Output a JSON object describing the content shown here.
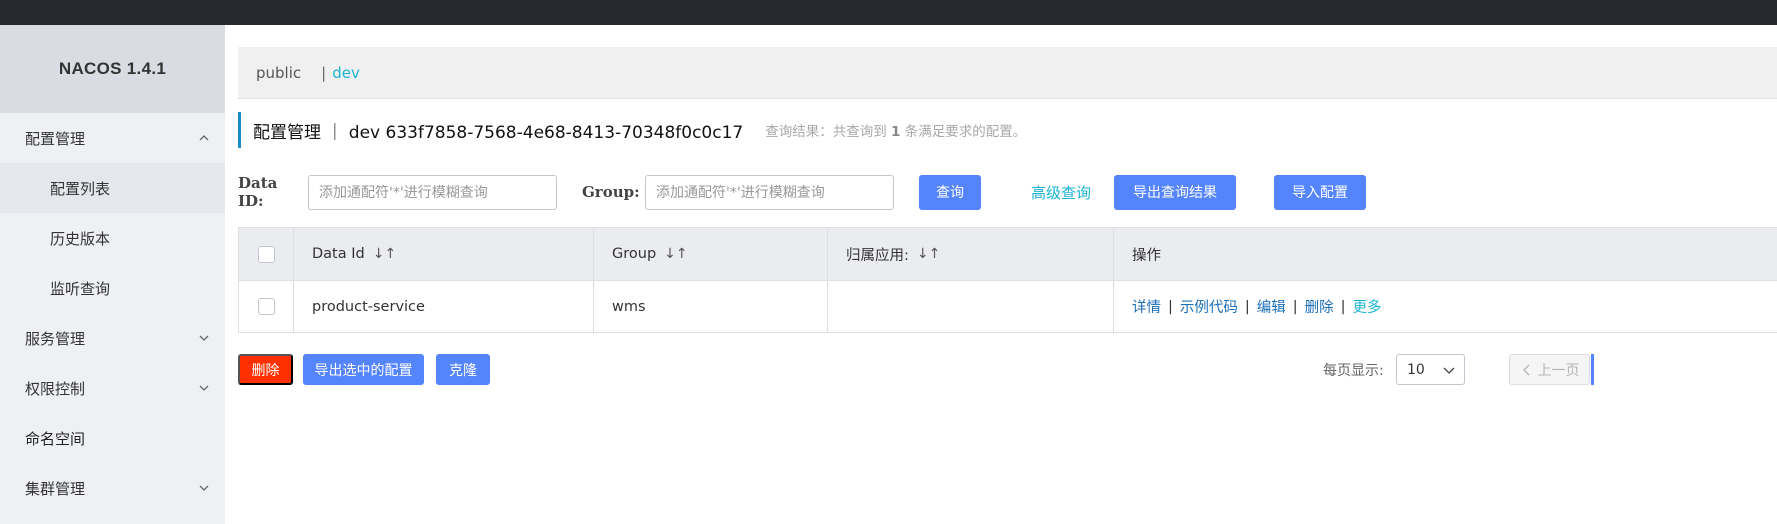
{
  "brand": "NACOS 1.4.1",
  "sidebar": {
    "items": [
      {
        "label": "配置管理",
        "expanded": true
      },
      {
        "label": "配置列表",
        "active": true
      },
      {
        "label": "历史版本"
      },
      {
        "label": "监听查询"
      },
      {
        "label": "服务管理"
      },
      {
        "label": "权限控制"
      },
      {
        "label": "命名空间"
      },
      {
        "label": "集群管理"
      }
    ]
  },
  "namespaces": {
    "public": "public",
    "separator": "|",
    "dev": "dev"
  },
  "header": {
    "title": "配置管理 ｜ dev  633f7858-7568-4e68-8413-70348f0c0c17",
    "result_prefix": "查询结果：共查询到",
    "result_count": "1",
    "result_suffix": "条满足要求的配置。"
  },
  "search": {
    "data_id_label": "Data ID:",
    "data_id_placeholder": "添加通配符'*'进行模糊查询",
    "group_label": "Group:",
    "group_placeholder": "添加通配符'*'进行模糊查询",
    "query_button": "查询",
    "advanced_link": "高级查询",
    "export_results_button": "导出查询结果",
    "import_button": "导入配置"
  },
  "table": {
    "columns": [
      "Data Id",
      "Group",
      "归属应用:",
      "操作"
    ],
    "sort_glyph": "↓↑",
    "rows": [
      {
        "data_id": "product-service",
        "group": "wms",
        "app": ""
      }
    ],
    "ops": {
      "detail": "详情",
      "sample": "示例代码",
      "edit": "编辑",
      "delete": "删除",
      "more": "更多",
      "sep": "|"
    }
  },
  "footer": {
    "delete_button": "删除",
    "export_selected_button": "导出选中的配置",
    "clone_button": "克隆",
    "per_page_label": "每页显示:",
    "per_page_value": "10",
    "prev_button": "上一页"
  },
  "colors": {
    "primary": "#5584ff",
    "danger": "#ff3000",
    "link": "#1d6fb8",
    "accent": "#1bb4d3",
    "topbar": "#262a2f"
  }
}
